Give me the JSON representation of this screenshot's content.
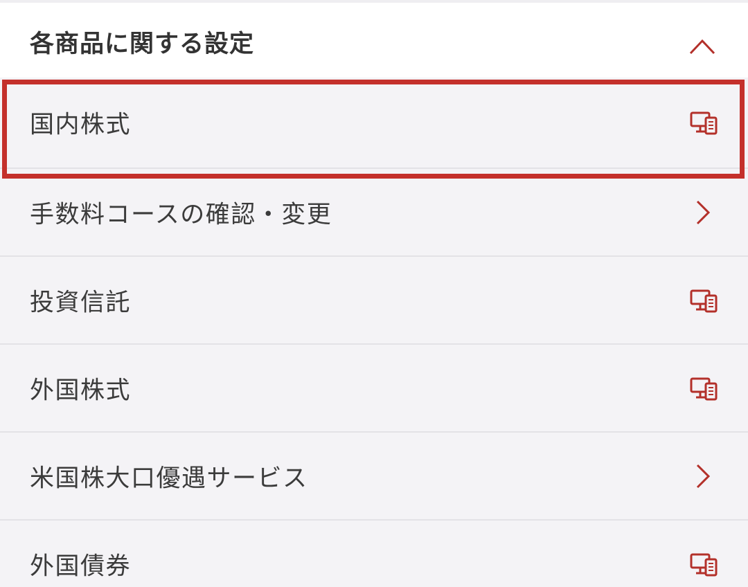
{
  "section": {
    "title": "各商品に関する設定",
    "toggle_icon": "chevron-up-icon"
  },
  "items": [
    {
      "label": "国内株式",
      "icon": "pc-mobile-icon"
    },
    {
      "label": "手数料コースの確認・変更",
      "icon": "chevron-right-icon"
    },
    {
      "label": "投資信託",
      "icon": "pc-mobile-icon"
    },
    {
      "label": "外国株式",
      "icon": "pc-mobile-icon"
    },
    {
      "label": "米国株大口優遇サービス",
      "icon": "chevron-right-icon"
    },
    {
      "label": "外国債券",
      "icon": "pc-mobile-icon"
    }
  ],
  "colors": {
    "accent": "#b3302a",
    "highlight_border": "#c4302b",
    "row_background": "#f4f3f6",
    "header_background": "#ffffff"
  }
}
